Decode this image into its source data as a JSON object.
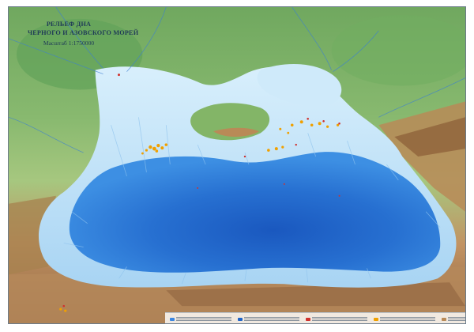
{
  "map": {
    "title_line1": "РЕЛЬЕФ ДНА",
    "title_line2": "ЧЕРНОГО И АЗОВСКОГО МОРЕЙ",
    "scale": "Масштаб 1:1750000"
  },
  "colors": {
    "deep_sea": "#1f64c8",
    "mid_sea": "#3b86e1",
    "shelf": "#a9d5f3",
    "shallow": "#cfeafa",
    "lowland": "#6fb06a",
    "hills": "#a6c77f",
    "mountains": "#b98a57",
    "high_mountains": "#8a5d36",
    "settlements": "#f0a000"
  },
  "legend": {
    "note": "legend items shown as symbols (unreadable text at this scale)"
  }
}
